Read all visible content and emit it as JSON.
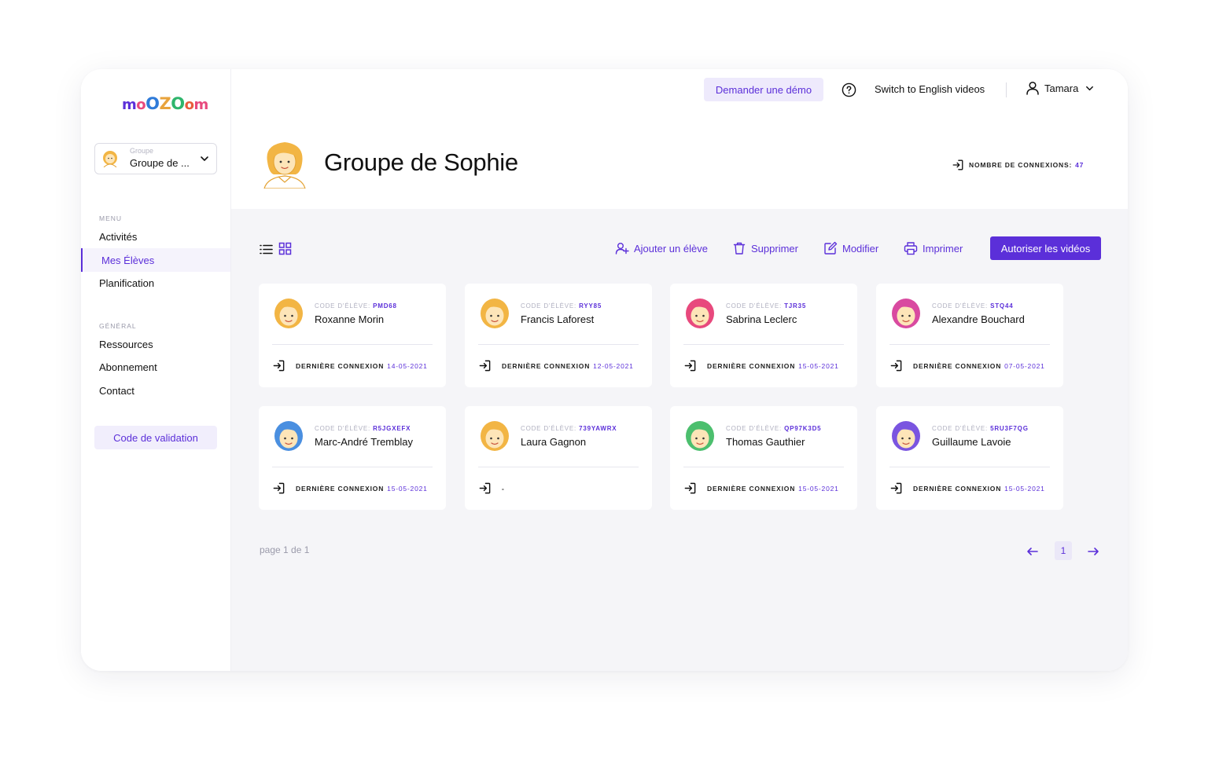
{
  "app": {
    "logo_letters": [
      "m",
      "o",
      "O",
      "Z",
      "O",
      "o",
      "m"
    ],
    "logo_colors": [
      "#5b2fd9",
      "#e8497d",
      "#2f7bd9",
      "#e8a33c",
      "#2fb56c",
      "#e85c3c",
      "#e8497d"
    ]
  },
  "sidebar": {
    "group_select_label": "Groupe",
    "group_select_value": "Groupe de ...",
    "menu_label": "MENU",
    "menu_items": [
      {
        "label": "Activités",
        "active": false
      },
      {
        "label": "Mes Élèves",
        "active": true
      },
      {
        "label": "Planification",
        "active": false
      }
    ],
    "general_label": "GÉNÉRAL",
    "general_items": [
      {
        "label": "Ressources"
      },
      {
        "label": "Abonnement"
      },
      {
        "label": "Contact"
      }
    ],
    "validation_button": "Code de validation"
  },
  "topbar": {
    "demo_button": "Demander une démo",
    "switch_language": "Switch to English videos",
    "user_name": "Tamara"
  },
  "header": {
    "group_title": "Groupe de Sophie",
    "connections_label": "NOMBRE DE CONNEXIONS:",
    "connections_value": "47"
  },
  "toolbar": {
    "add_student": "Ajouter un élève",
    "delete": "Supprimer",
    "edit": "Modifier",
    "print": "Imprimer",
    "allow_videos": "Autoriser les vidéos"
  },
  "student_code_label": "CODE D'ÉLÈVE:",
  "last_connection_label": "DERNIÈRE CONNEXION",
  "students": [
    {
      "code": "PMD68",
      "name": "Roxanne Morin",
      "last": "14-05-2021",
      "color": "#f2b544"
    },
    {
      "code": "RYY85",
      "name": "Francis Laforest",
      "last": "12-05-2021",
      "color": "#f2b544"
    },
    {
      "code": "TJR35",
      "name": "Sabrina Leclerc",
      "last": "15-05-2021",
      "color": "#e8497d"
    },
    {
      "code": "STQ44",
      "name": "Alexandre Bouchard",
      "last": "07-05-2021",
      "color": "#d94aa0"
    },
    {
      "code": "R5JGXEFX",
      "name": "Marc-André Tremblay",
      "last": "15-05-2021",
      "color": "#4a8fe0"
    },
    {
      "code": "739YAWRX",
      "name": "Laura Gagnon",
      "last": "",
      "no_connection": "-",
      "color": "#f2b544"
    },
    {
      "code": "QP97K3D5",
      "name": "Thomas Gauthier",
      "last": "15-05-2021",
      "color": "#4cbf6e"
    },
    {
      "code": "5RU3F7QG",
      "name": "Guillaume Lavoie",
      "last": "15-05-2021",
      "color": "#7a55e0"
    }
  ],
  "pagination": {
    "text": "page 1 de 1",
    "current": "1"
  },
  "colors": {
    "accent": "#5b2fd9",
    "accent_light": "#eeeafc",
    "content_bg": "#f5f5f8"
  }
}
